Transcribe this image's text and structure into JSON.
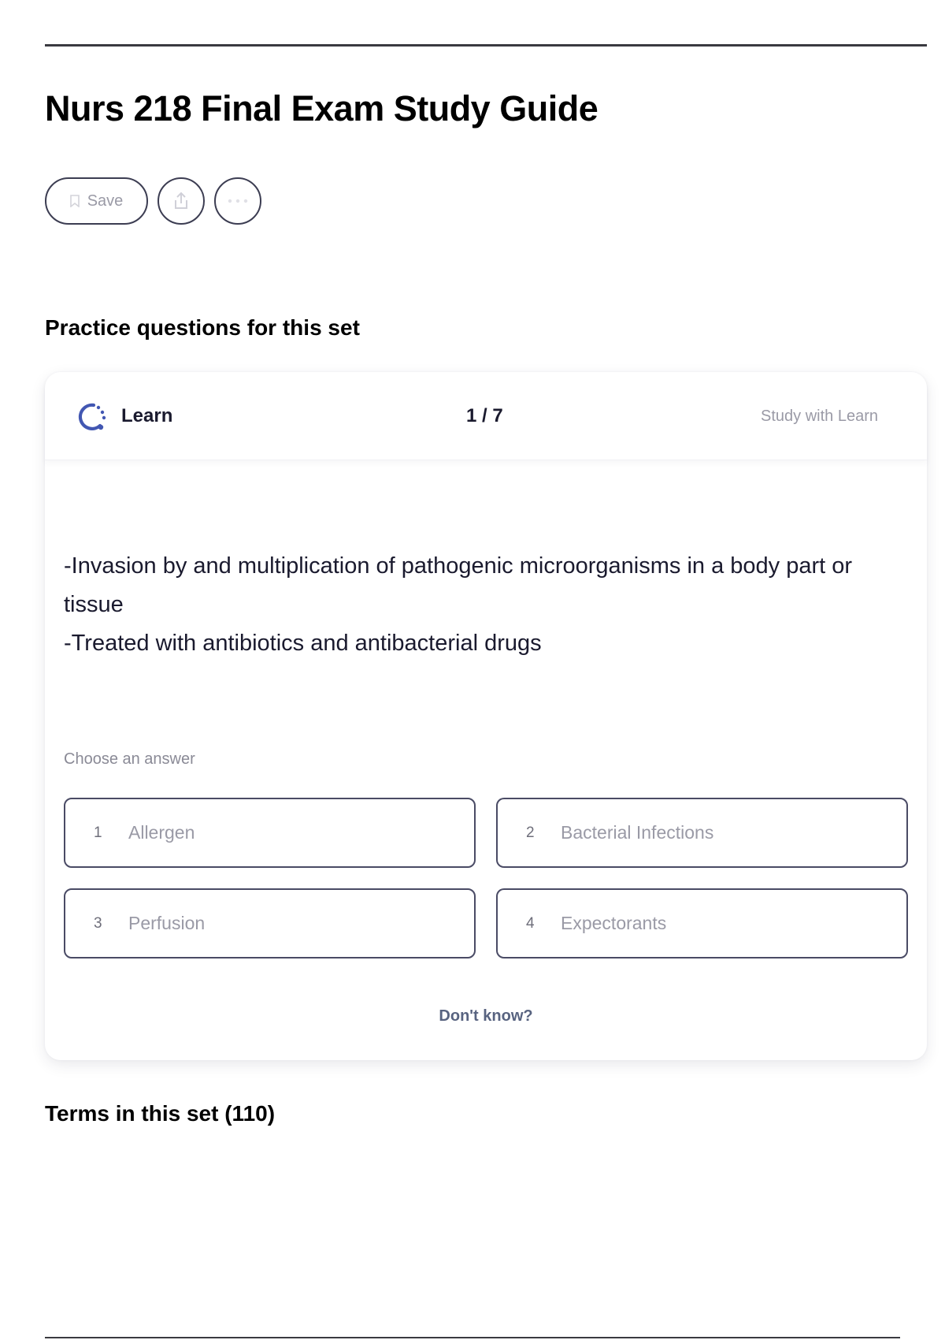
{
  "page": {
    "title": "Nurs 218 Final Exam Study Guide"
  },
  "actions": {
    "save_label": "Save",
    "save_icon": "bookmark-icon",
    "share_icon": "share-icon",
    "more_icon": "more-icon"
  },
  "practice": {
    "heading": "Practice questions for this set",
    "mode_label": "Learn",
    "mode_icon": "learn-icon",
    "progress": "1 / 7",
    "study_link": "Study with Learn",
    "definition_lines": [
      "-Invasion by and multiplication of pathogenic microorganisms in a body part or tissue",
      "-Treated with antibiotics and antibacterial drugs"
    ],
    "choose_label": "Choose an answer",
    "options": [
      {
        "number": "1",
        "text": "Allergen"
      },
      {
        "number": "2",
        "text": "Bacterial Infections"
      },
      {
        "number": "3",
        "text": "Perfusion"
      },
      {
        "number": "4",
        "text": "Expectorants"
      }
    ],
    "dont_know": "Don't know?"
  },
  "terms": {
    "heading": "Terms in this set (110)"
  },
  "colors": {
    "learn_accent": "#4257b2",
    "border": "#4a4b65",
    "muted_text": "#9a9aa6"
  }
}
